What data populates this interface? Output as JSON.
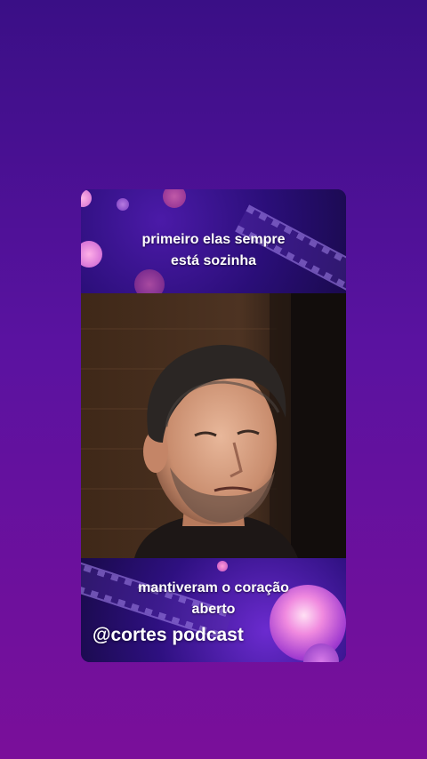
{
  "captions": {
    "top": [
      "primeiro elas sempre",
      "está sozinha"
    ],
    "bottom": [
      "mantiveram o coração",
      "aberto"
    ]
  },
  "watermark": "@cortes podcast",
  "colors": {
    "background_top": "#3a0f86",
    "background_bottom": "#7a0f9a",
    "panel_accent": "#4b1aa8",
    "bokeh_pink": "#ff9ad8",
    "caption_text": "#ffffff"
  },
  "media": {
    "subject": "man-portrait-photo"
  }
}
